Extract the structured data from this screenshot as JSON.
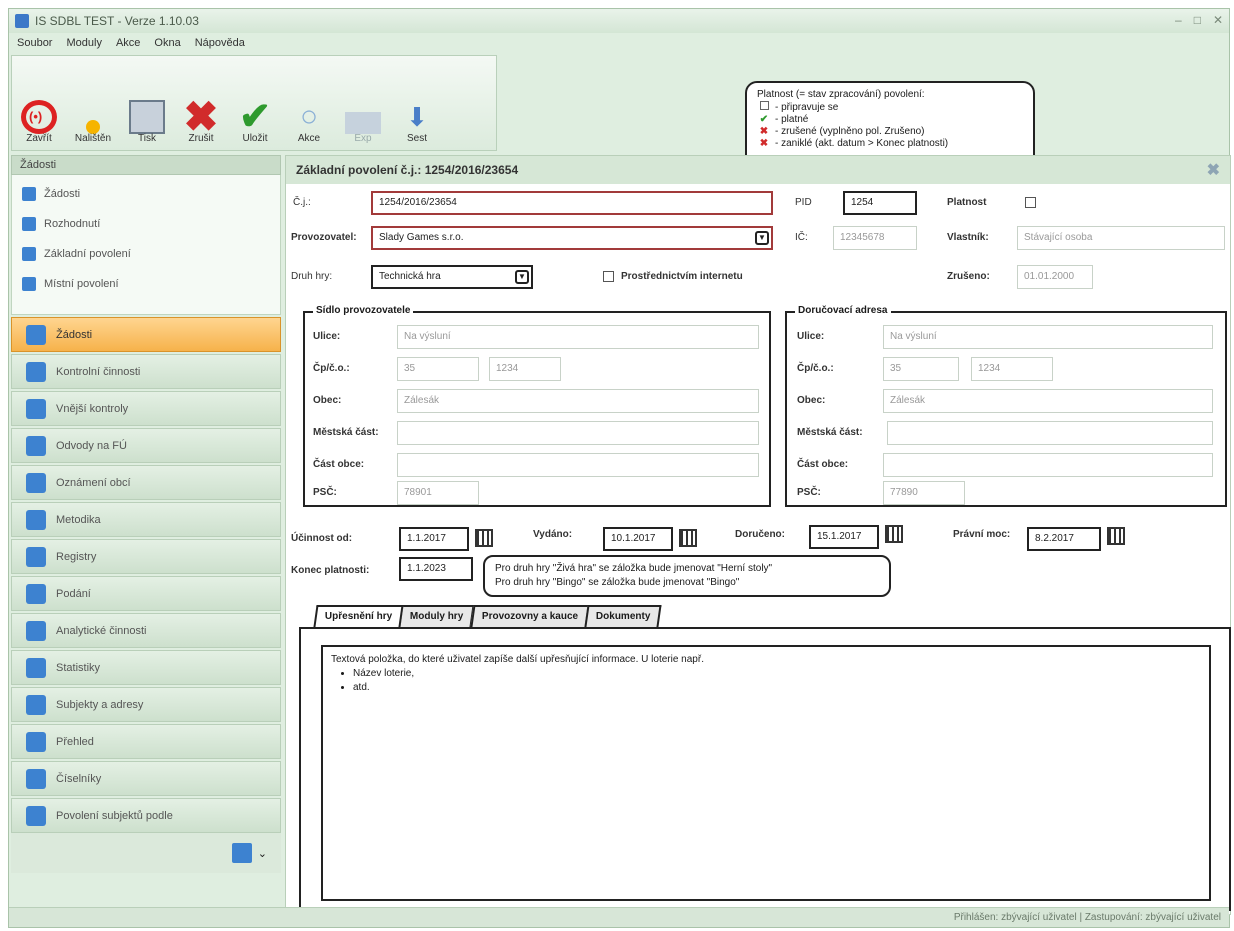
{
  "window": {
    "title": "IS SDBL TEST - Verze 1.10.03"
  },
  "menu": [
    "Soubor",
    "Moduly",
    "Akce",
    "Okna",
    "Nápověda"
  ],
  "toolbar": {
    "buttons": [
      {
        "label": "Zavřít",
        "icon": "close-circle-icon"
      },
      {
        "label": "Nalištěn",
        "icon": "new-star-icon"
      },
      {
        "label": "Tisk",
        "icon": "printer-icon"
      },
      {
        "label": "Zrušit",
        "icon": "cancel-x-icon"
      },
      {
        "label": "Uložit",
        "icon": "save-check-icon"
      },
      {
        "label": "Akce",
        "icon": "search-icon"
      },
      {
        "label": "Exp",
        "icon": "grid-icon"
      },
      {
        "label": "Sest",
        "icon": "download-icon"
      }
    ]
  },
  "legend": {
    "title": "Platnost (= stav zpracování) povolení:",
    "items": [
      {
        "mark": "empty",
        "text": "- připravuje se"
      },
      {
        "mark": "check",
        "text": "- platné"
      },
      {
        "mark": "x",
        "text": "- zrušené (vyplněno pol. Zrušeno)"
      },
      {
        "mark": "x",
        "text": "- zaniklé (akt. datum > Konec platnosti)"
      }
    ]
  },
  "sidebar": {
    "header": "Žádosti",
    "top_items": [
      "Žádosti",
      "Rozhodnutí",
      "Základní povolení",
      "Místní povolení"
    ],
    "nav": [
      {
        "label": "Žádosti",
        "active": true
      },
      {
        "label": "Kontrolní činnosti",
        "active": false
      },
      {
        "label": "Vnější kontroly",
        "active": false
      },
      {
        "label": "Odvody na FÚ",
        "active": false
      },
      {
        "label": "Oznámení obcí",
        "active": false
      },
      {
        "label": "Metodika",
        "active": false
      },
      {
        "label": "Registry",
        "active": false
      },
      {
        "label": "Podání",
        "active": false
      },
      {
        "label": "Analytické činnosti",
        "active": false
      },
      {
        "label": "Statistiky",
        "active": false
      },
      {
        "label": "Subjekty a adresy",
        "active": false
      },
      {
        "label": "Přehled",
        "active": false
      },
      {
        "label": "Číselníky",
        "active": false
      },
      {
        "label": "Povolení subjektů podle",
        "active": false
      }
    ]
  },
  "form": {
    "header": "Základní povolení č.j.: 1254/2016/23654",
    "cj_label": "Č.j.:",
    "cj_value": "1254/2016/23654",
    "pid_label": "PID",
    "pid_value": "1254",
    "platnost_label": "Platnost",
    "provozovatel_label": "Provozovatel:",
    "provozovatel_value": "Slady Games s.r.o.",
    "ic_label": "IČ:",
    "ic_value": "12345678",
    "vlastnik_label": "Vlastník:",
    "vlastnik_value": "Stávající osoba",
    "druh_label": "Druh hry:",
    "druh_value": "Technická hra",
    "internet_label": "Prostřednictvím internetu",
    "zruseno_label": "Zrušeno:",
    "zruseno_value": "01.01.2000",
    "sidlo": {
      "title": "Sídlo provozovatele",
      "ulice_label": "Ulice:",
      "ulice_value": "Na výsluní",
      "cp_label": "Čp/č.o.:",
      "cp_value": "35",
      "co_value": "1234",
      "obec_label": "Obec:",
      "obec_value": "Zálesák",
      "mest_label": "Městská část:",
      "mest_value": "",
      "cast_label": "Část obce:",
      "cast_value": "",
      "psc_label": "PSČ:",
      "psc_value": "78901"
    },
    "dorucovaci": {
      "title": "Doručovací adresa",
      "ulice_label": "Ulice:",
      "ulice_value": "Na výsluní",
      "cp_label": "Čp/č.o.:",
      "cp_value": "35",
      "co_value": "1234",
      "obec_label": "Obec:",
      "obec_value": "Zálesák",
      "mest_label": "Městská část:",
      "mest_value": "",
      "cast_label": "Část obce:",
      "cast_value": "",
      "psc_label": "PSČ:",
      "psc_value": "77890"
    },
    "ucinnost_label": "Účinnost od:",
    "ucinnost_value": "1.1.2017",
    "vydano_label": "Vydáno:",
    "vydano_value": "10.1.2017",
    "doruceno_label": "Doručeno:",
    "doruceno_value": "15.1.2017",
    "pravni_label": "Právní moc:",
    "pravni_value": "8.2.2017",
    "konec_label": "Konec platnosti:",
    "konec_value": "1.1.2023"
  },
  "note_bubble": {
    "line1": "Pro druh hry \"Živá hra\" se záložka bude jmenovat \"Herní stoly\"",
    "line2": "Pro druh hry \"Bingo\" se záložka bude jmenovat \"Bingo\""
  },
  "tabs": [
    "Upřesnění hry",
    "Moduly hry",
    "Provozovny a kauce",
    "Dokumenty"
  ],
  "textarea": {
    "line": "Textová položka, do které uživatel zapíše další upřesňující informace. U loterie např.",
    "bullets": [
      "Název loterie,",
      "atd."
    ]
  },
  "status": "Přihlášen: zbývající uživatel | Zastupování: zbývající uživatel"
}
